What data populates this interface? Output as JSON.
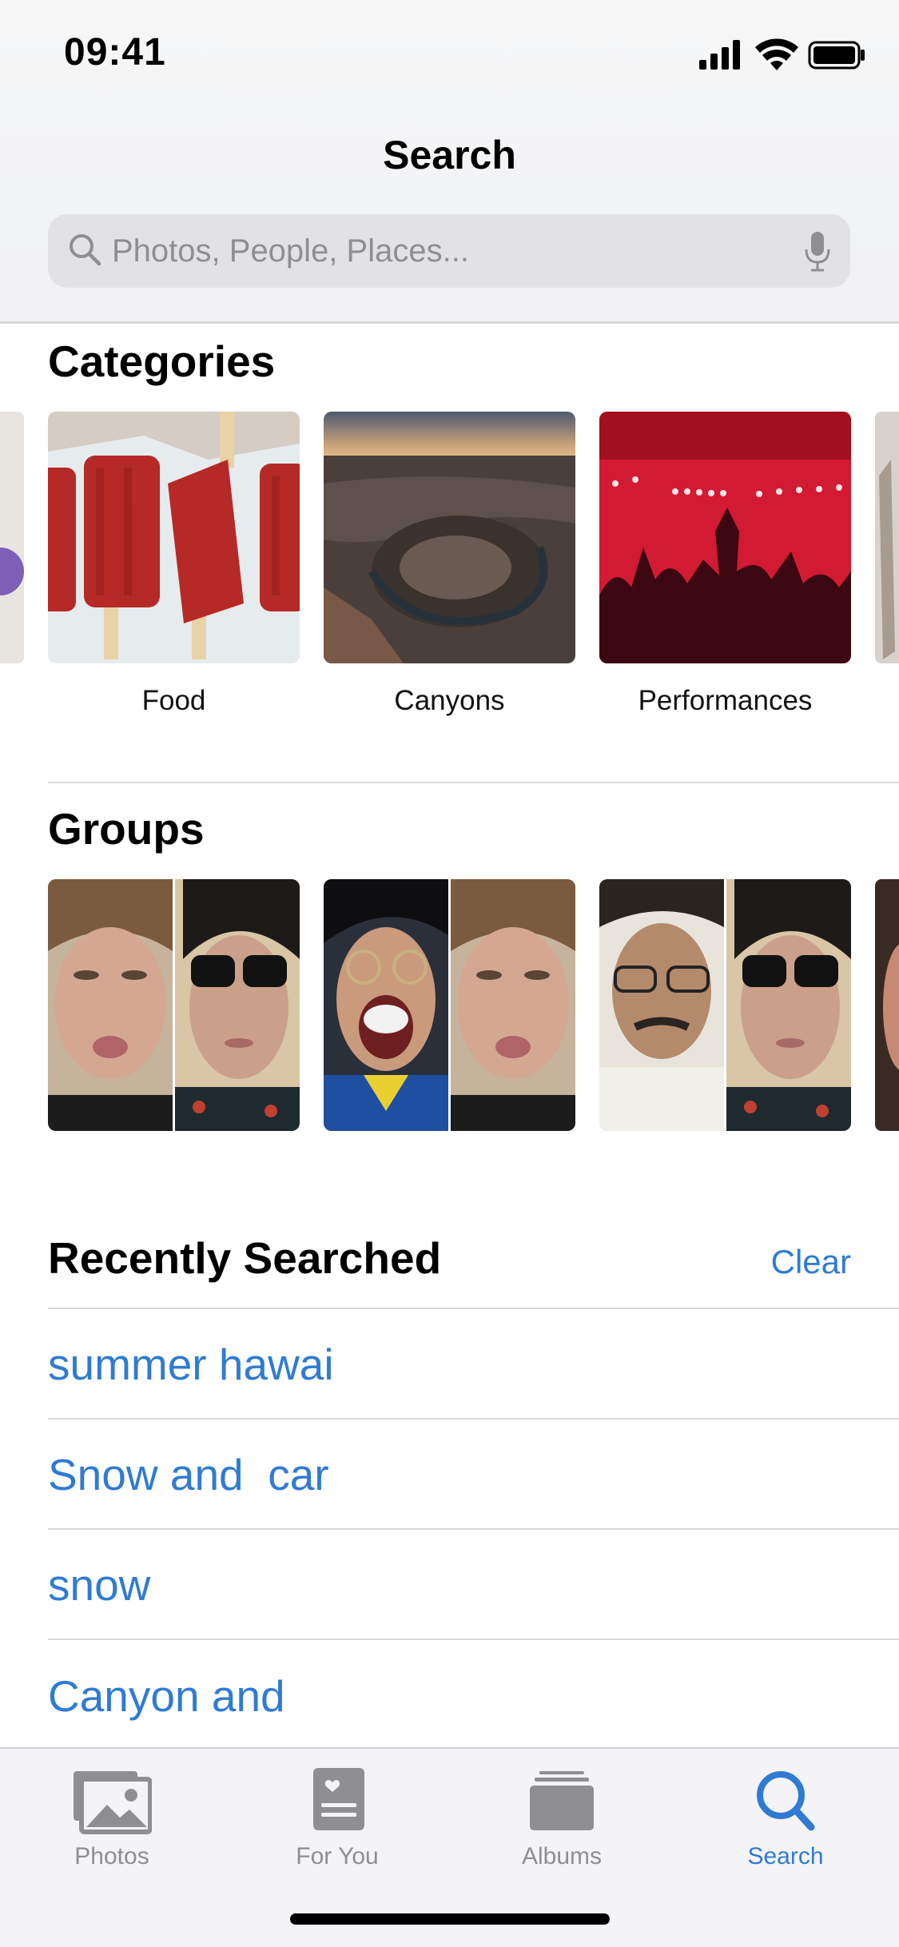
{
  "status_bar": {
    "time": "09:41"
  },
  "header": {
    "title": "Search"
  },
  "search": {
    "placeholder": "Photos, People, Places..."
  },
  "categories": {
    "title": "Categories",
    "items": [
      {
        "label": "Food"
      },
      {
        "label": "Canyons"
      },
      {
        "label": "Performances"
      }
    ]
  },
  "groups": {
    "title": "Groups"
  },
  "recent": {
    "title": "Recently Searched",
    "clear_label": "Clear",
    "items": [
      {
        "label": "summer hawai"
      },
      {
        "label": "Snow and  car"
      },
      {
        "label": "snow"
      },
      {
        "label": "Canyon and"
      }
    ]
  },
  "tabbar": {
    "tabs": [
      {
        "label": "Photos",
        "icon": "photos-icon"
      },
      {
        "label": "For You",
        "icon": "for-you-icon"
      },
      {
        "label": "Albums",
        "icon": "albums-icon"
      },
      {
        "label": "Search",
        "icon": "search-icon",
        "active": true
      }
    ]
  },
  "colors": {
    "accent": "#2f7bd4",
    "inactive": "#8e8e93"
  }
}
